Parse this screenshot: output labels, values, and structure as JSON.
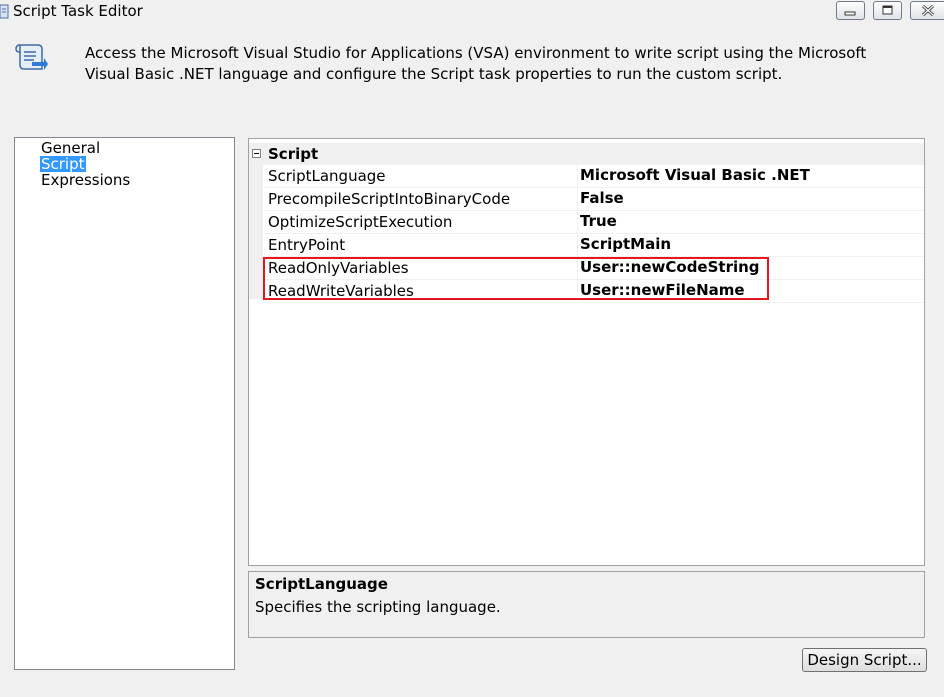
{
  "window": {
    "title": "Script Task Editor",
    "buttons": {
      "minimize": "minimize-icon",
      "maximize": "maximize-icon",
      "close": "close-icon"
    }
  },
  "header": {
    "icon": "script-task-icon",
    "description": "Access the Microsoft Visual Studio for Applications (VSA) environment to write script using the Microsoft Visual Basic .NET language and configure the Script task properties to run the custom script."
  },
  "nav": {
    "items": [
      {
        "label": "General",
        "selected": false
      },
      {
        "label": "Script",
        "selected": true
      },
      {
        "label": "Expressions",
        "selected": false
      }
    ]
  },
  "grid": {
    "category": "Script",
    "rows": [
      {
        "name": "ScriptLanguage",
        "value": "Microsoft Visual Basic .NET"
      },
      {
        "name": "PrecompileScriptIntoBinaryCode",
        "value": "False"
      },
      {
        "name": "OptimizeScriptExecution",
        "value": "True"
      },
      {
        "name": "EntryPoint",
        "value": "ScriptMain"
      },
      {
        "name": "ReadOnlyVariables",
        "value": "User::newCodeString"
      },
      {
        "name": "ReadWriteVariables",
        "value": "User::newFileName"
      }
    ],
    "highlight_color": "#e8161b"
  },
  "help": {
    "title": "ScriptLanguage",
    "text": "Specifies the scripting language."
  },
  "footer": {
    "design_label": "Design Script..."
  },
  "colors": {
    "selection": "#3399ff",
    "background": "#f0f0f0"
  }
}
